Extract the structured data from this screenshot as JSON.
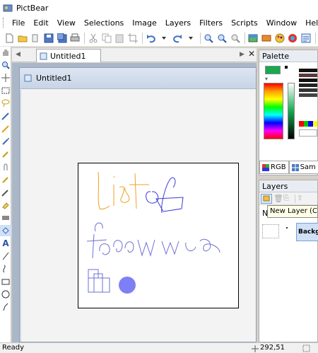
{
  "app": {
    "title": "PictBear"
  },
  "menu": [
    "File",
    "Edit",
    "View",
    "Selections",
    "Image",
    "Layers",
    "Filters",
    "Scripts",
    "Window",
    "Help"
  ],
  "document": {
    "tab_label": "Untitled1",
    "window_title": "Untitled1"
  },
  "palette": {
    "title": "Palette",
    "tabs": [
      "RGB",
      "Sam"
    ],
    "colors": {
      "foreground": "#16a94f",
      "swatches": [
        "#ff0000",
        "#00c800",
        "#0000ff",
        "#ffff00",
        "#ff00ff",
        "#00ffff"
      ]
    }
  },
  "layers": {
    "title": "Layers",
    "tooltip": "New Layer (Ctrl",
    "layer_name": "Backgr",
    "marker": "N"
  },
  "status": {
    "text": "Ready",
    "coords": "292,51"
  },
  "colors": {
    "orange_stroke": "#f0a020",
    "blue_stroke": "#3a3ad8",
    "lavender_stroke": "#6f6fd6",
    "circle_fill": "#7f7ff5"
  }
}
